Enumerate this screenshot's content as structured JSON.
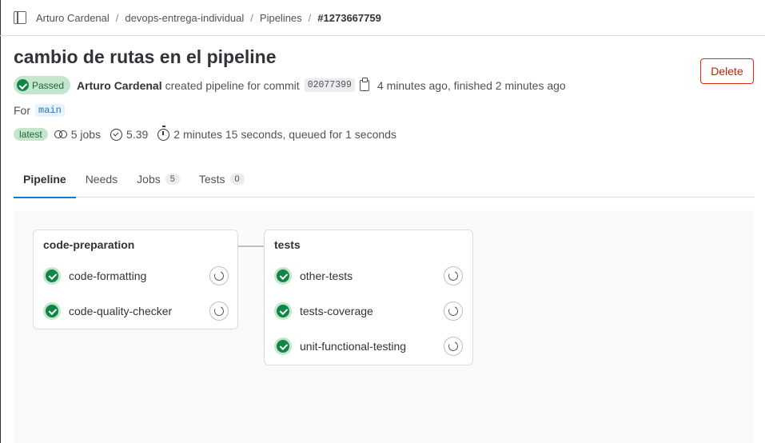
{
  "breadcrumb": {
    "items": [
      "Arturo Cardenal",
      "devops-entrega-individual",
      "Pipelines"
    ],
    "current": "#1273667759",
    "separator": "/"
  },
  "pipeline": {
    "title": "cambio de rutas en el pipeline",
    "status_label": "Passed",
    "author": "Arturo Cardenal",
    "created_text": "created pipeline for commit",
    "commit_sha": "02077399",
    "time_text": "4 minutes ago, finished 2 minutes ago",
    "for_label": "For",
    "branch": "main",
    "delete_label": "Delete"
  },
  "stats": {
    "latest_label": "latest",
    "jobs": "5 jobs",
    "compute": "5.39",
    "duration": "2 minutes 15 seconds, queued for 1 seconds"
  },
  "tabs": [
    {
      "label": "Pipeline",
      "count": null,
      "active": true
    },
    {
      "label": "Needs",
      "count": null,
      "active": false
    },
    {
      "label": "Jobs",
      "count": "5",
      "active": false
    },
    {
      "label": "Tests",
      "count": "0",
      "active": false
    }
  ],
  "stages": [
    {
      "name": "code-preparation",
      "jobs": [
        "code-formatting",
        "code-quality-checker"
      ]
    },
    {
      "name": "tests",
      "jobs": [
        "other-tests",
        "tests-coverage",
        "unit-functional-testing"
      ]
    }
  ],
  "colors": {
    "success": "#108548",
    "success_bg": "#c3e6cd",
    "danger": "#dd2b0e",
    "accent": "#1f75cb"
  }
}
